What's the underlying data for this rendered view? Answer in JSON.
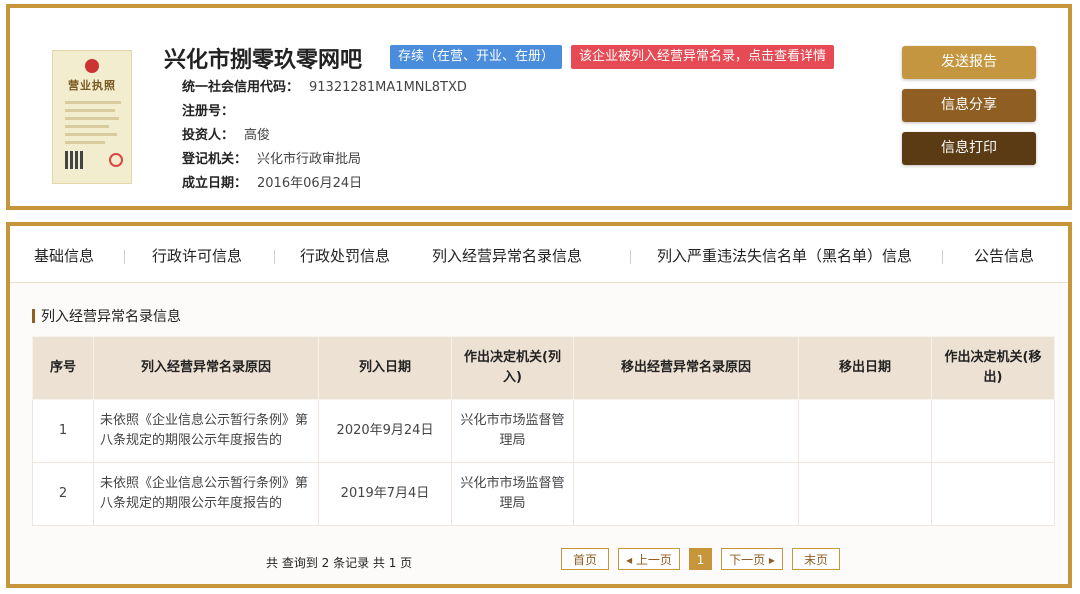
{
  "company": {
    "name": "兴化市捌零玖零网吧",
    "status_badge": "存续（在营、开业、在册）",
    "warning_badge": "该企业被列入经营异常名录，点击查看详情",
    "license_title": "营业执照"
  },
  "info": [
    {
      "label": "统一社会信用代码：",
      "value": "91321281MA1MNL8TXD"
    },
    {
      "label": "注册号：",
      "value": ""
    },
    {
      "label": "投资人：",
      "value": "高俊"
    },
    {
      "label": "登记机关：",
      "value": "兴化市行政审批局"
    },
    {
      "label": "成立日期：",
      "value": "2016年06月24日"
    }
  ],
  "actions": {
    "report": "发送报告",
    "share": "信息分享",
    "print": "信息打印"
  },
  "tabs": [
    "基础信息",
    "行政许可信息",
    "行政处罚信息",
    "列入经营异常名录信息",
    "列入严重违法失信名单（黑名单）信息",
    "公告信息"
  ],
  "section": {
    "title": "列入经营异常名录信息"
  },
  "table": {
    "headers": [
      "序号",
      "列入经营异常名录原因",
      "列入日期",
      "作出决定机关(列入)",
      "移出经营异常名录原因",
      "移出日期",
      "作出决定机关(移出)"
    ],
    "rows": [
      {
        "no": "1",
        "reason": "未依照《企业信息公示暂行条例》第八条规定的期限公示年度报告的",
        "date": "2020年9月24日",
        "authority": "兴化市市场监督管理局",
        "remove_reason": "",
        "remove_date": "",
        "remove_authority": ""
      },
      {
        "no": "2",
        "reason": "未依照《企业信息公示暂行条例》第八条规定的期限公示年度报告的",
        "date": "2019年7月4日",
        "authority": "兴化市市场监督管理局",
        "remove_reason": "",
        "remove_date": "",
        "remove_authority": ""
      }
    ]
  },
  "pager": {
    "summary": "共 查询到 2 条记录 共 1 页",
    "first": "首页",
    "prev": "◂ 上一页",
    "current": "1",
    "next": "下一页 ▸",
    "last": "末页"
  },
  "colors": {
    "gold": "#c8963a",
    "red": "#e64b55",
    "blue": "#4a8ddc",
    "brown": "#8e5e22",
    "dark_brown": "#5a3b14"
  }
}
